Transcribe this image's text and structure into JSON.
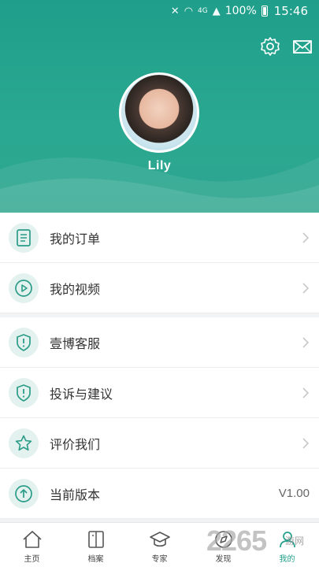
{
  "status_bar": {
    "battery": "100%",
    "time": "15:46",
    "network": "4G"
  },
  "header": {
    "username": "Lily"
  },
  "menu": {
    "items": [
      {
        "label": "我的订单"
      },
      {
        "label": "我的视频"
      },
      {
        "label": "壹博客服"
      },
      {
        "label": "投诉与建议"
      },
      {
        "label": "评价我们"
      },
      {
        "label": "当前版本",
        "value": "V1.00"
      }
    ]
  },
  "tabbar": {
    "tabs": [
      {
        "label": "主页"
      },
      {
        "label": "档案"
      },
      {
        "label": "专家"
      },
      {
        "label": "发现"
      },
      {
        "label": "我的"
      }
    ]
  },
  "watermark": {
    "text": "2265",
    "suffix": "游网"
  },
  "colors": {
    "primary": "#23a08b",
    "icon_bg": "#e4f2ef"
  }
}
